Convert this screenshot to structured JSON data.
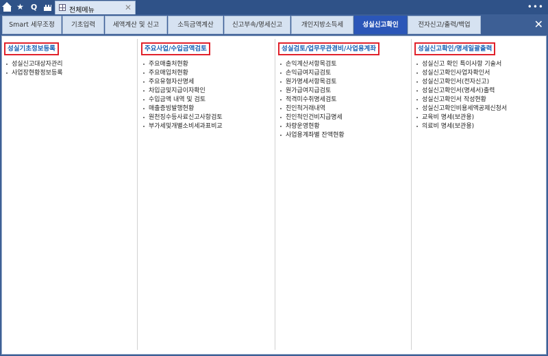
{
  "topbar": {
    "doc_tab_label": "전체메뉴"
  },
  "tabs": [
    {
      "label": "Smart 세무조정",
      "active": false
    },
    {
      "label": "기초입력",
      "active": false
    },
    {
      "label": "세액계산 및 신고",
      "active": false
    },
    {
      "label": "소득금액계산",
      "active": false
    },
    {
      "label": "신고부속/명세신고",
      "active": false
    },
    {
      "label": "개인지방소득세",
      "active": false
    },
    {
      "label": "성실신고확인",
      "active": true
    },
    {
      "label": "전자신고/출력/백업",
      "active": false
    }
  ],
  "columns": [
    {
      "title": "성실기초정보등록",
      "items": [
        "성실신고대상자관리",
        "사업장현황정보등록"
      ]
    },
    {
      "title": "주요사업/수입금액검토",
      "items": [
        "주요매출처현황",
        "주요매입처현황",
        "주요유형자산명세",
        "차입금및지급이자확인",
        "수입금액 내역 및 검토",
        "매출증빙발행현황",
        "원천징수등사료신고사항검토",
        "부가세및개별소비세과표비교"
      ]
    },
    {
      "title": "성실검토/업무무관경비/사업용계좌",
      "items": [
        "손익계산서항목검토",
        "손익급여지급검토",
        "원가명세서항목검토",
        "원가급여지급검토",
        "적격미수취명세검토",
        "친인척거래내역",
        "친인척인건비지급명세",
        "차량운영현황",
        "사업용계좌별 잔액현황"
      ]
    },
    {
      "title": "성실신고확인/명세일괄출력",
      "items": [
        "성실신고 확인 특이사항 기술서",
        "성실신고확인사업자확인서",
        "성실신고확인서(전자신고)",
        "성실신고확인서(명세서)출력",
        "성실신고확인서 작성현황",
        "성실신고확인비용세액공제신청서",
        "교육비 명세(보관용)",
        "의료비 명세(보관용)"
      ]
    }
  ]
}
